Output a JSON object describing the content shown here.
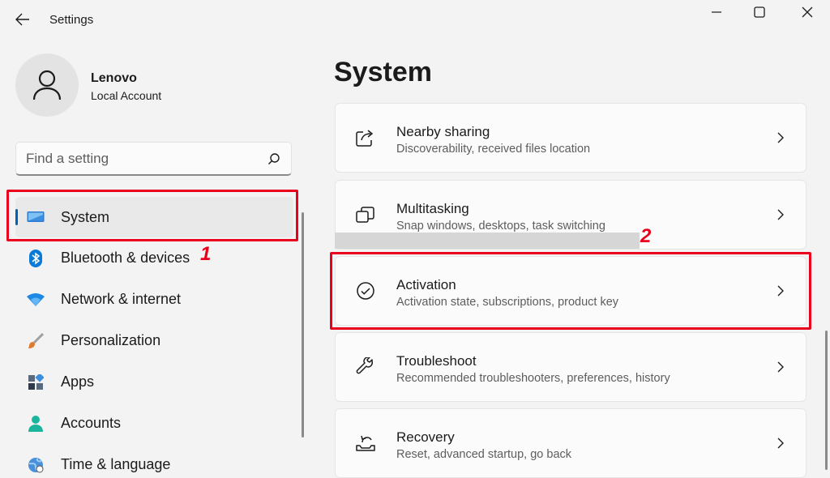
{
  "window": {
    "title": "Settings",
    "controls": [
      "minimize-icon",
      "maximize-icon",
      "close-icon"
    ]
  },
  "profile": {
    "name": "Lenovo",
    "account_type": "Local Account"
  },
  "search": {
    "placeholder": "Find a setting"
  },
  "sidebar": {
    "items": [
      {
        "label": "System",
        "icon": "system-icon",
        "active": true
      },
      {
        "label": "Bluetooth & devices",
        "icon": "bluetooth-icon"
      },
      {
        "label": "Network & internet",
        "icon": "wifi-icon"
      },
      {
        "label": "Personalization",
        "icon": "brush-icon"
      },
      {
        "label": "Apps",
        "icon": "apps-icon"
      },
      {
        "label": "Accounts",
        "icon": "person-icon"
      },
      {
        "label": "Time & language",
        "icon": "globe-icon"
      }
    ]
  },
  "main": {
    "title": "System",
    "cards": [
      {
        "title": "Nearby sharing",
        "subtitle": "Discoverability, received files location",
        "icon": "share-icon"
      },
      {
        "title": "Multitasking",
        "subtitle": "Snap windows, desktops, task switching",
        "icon": "multitasking-icon"
      },
      {
        "title": "Activation",
        "subtitle": "Activation state, subscriptions, product key",
        "icon": "check-circle-icon"
      },
      {
        "title": "Troubleshoot",
        "subtitle": "Recommended troubleshooters, preferences, history",
        "icon": "wrench-icon"
      },
      {
        "title": "Recovery",
        "subtitle": "Reset, advanced startup, go back",
        "icon": "recovery-icon"
      }
    ]
  },
  "annotations": {
    "step1": "1",
    "step2": "2"
  },
  "colors": {
    "accent": "#005fb8",
    "annotation": "#e8001c",
    "background": "#f3f3f3"
  }
}
